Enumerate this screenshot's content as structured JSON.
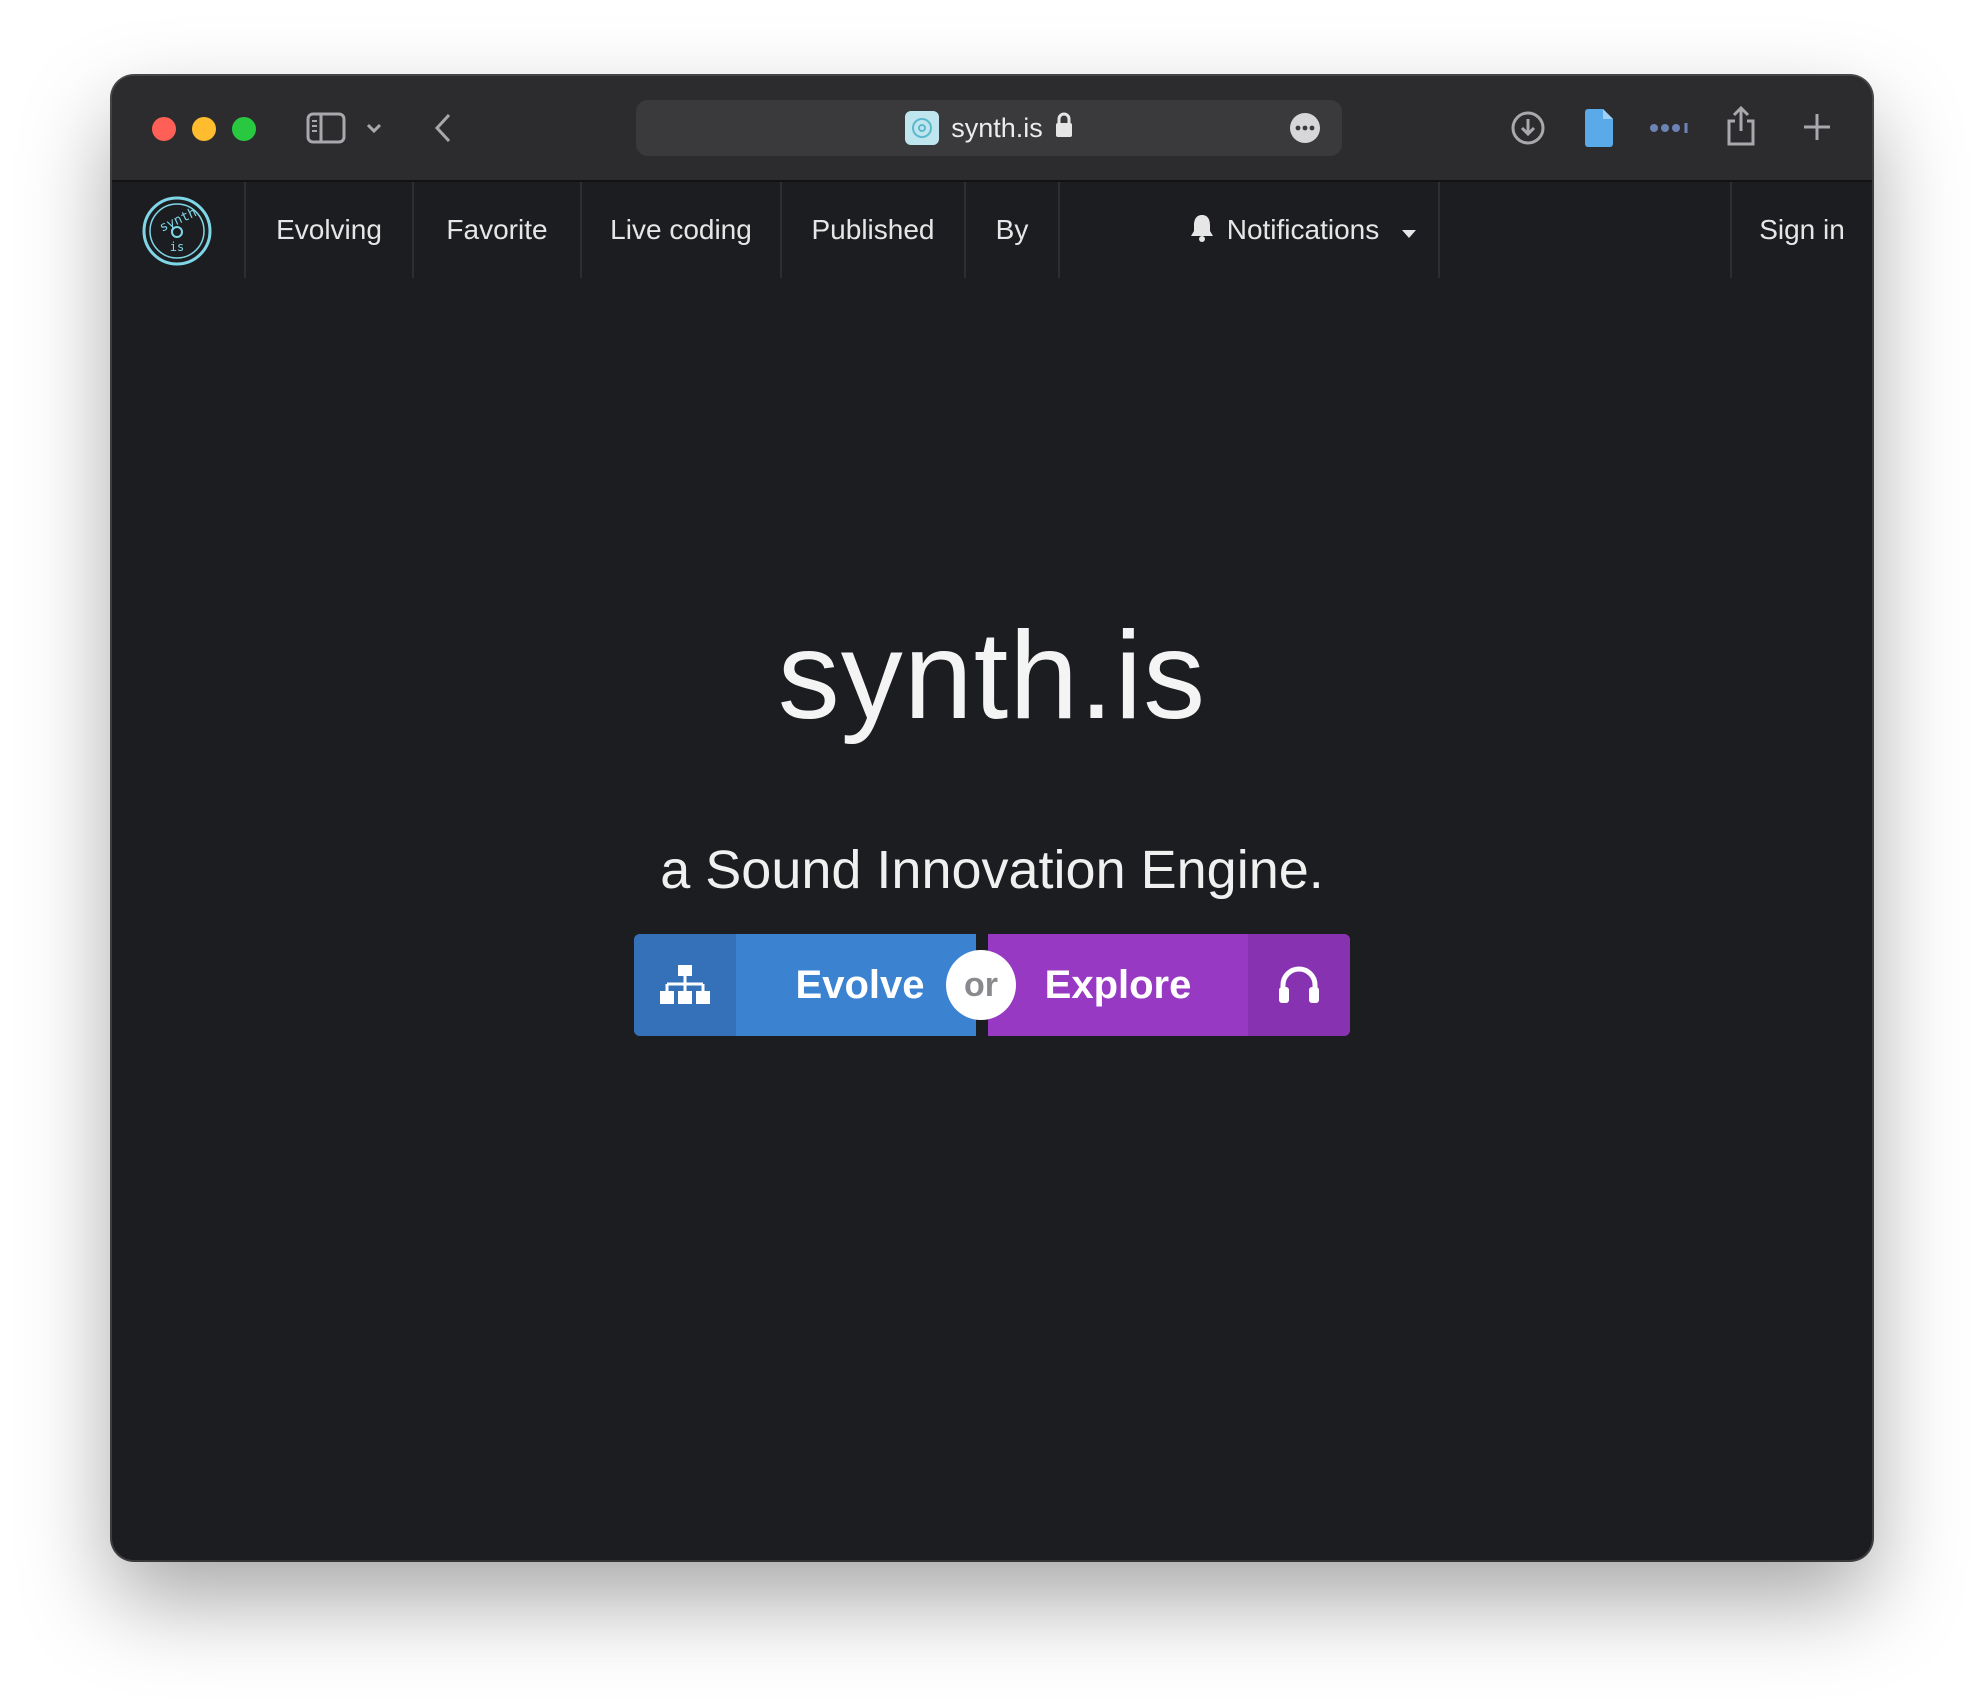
{
  "browser": {
    "url": "synth.is",
    "icons": {
      "sidebar": "sidebar-icon",
      "sidebar_menu": "chevron-down-icon",
      "back": "chevron-left-icon",
      "lock": "lock-icon",
      "page_menu": "ellipsis-circle-icon",
      "downloads": "download-icon",
      "notes": "document-icon",
      "extensions": "dots-icon",
      "share": "share-icon",
      "new_tab": "plus-icon"
    }
  },
  "nav": {
    "logo_text_top": "synth",
    "logo_text_bottom": "is",
    "items": [
      "Evolving",
      "Favorite",
      "Live coding",
      "Published",
      "By"
    ],
    "notifications": "Notifications",
    "sign_in": "Sign in"
  },
  "hero": {
    "title": "synth.is",
    "subtitle": "a Sound Innovation Engine.",
    "evolve_label": "Evolve",
    "or_label": "or",
    "explore_label": "Explore"
  },
  "colors": {
    "background": "#1c1d20",
    "toolbar": "#2c2c2e",
    "evolve": "#3b82d0",
    "explore": "#9839c4",
    "logo": "#7fd6e6"
  }
}
